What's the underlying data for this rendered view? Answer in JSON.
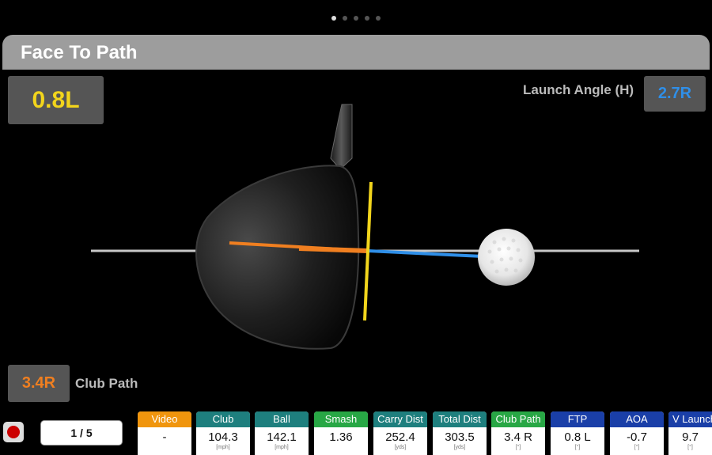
{
  "pager": {
    "page_count": 5,
    "active_index": 0
  },
  "header": {
    "title": "Face To Path"
  },
  "face_to_path": {
    "value": "0.8L",
    "color": "#f2d51c"
  },
  "launch_angle_h": {
    "label": "Launch Angle (H)",
    "value": "2.7R",
    "color": "#2f8fe8"
  },
  "club_path": {
    "label": "Club Path",
    "value": "3.4R",
    "color": "#f07f20"
  },
  "footer": {
    "record_icon": "record-icon",
    "counter": "1 / 5",
    "metrics": [
      {
        "label": "Video",
        "value": "-",
        "unit": "",
        "color": "#f0950d"
      },
      {
        "label": "Club",
        "value": "104.3",
        "unit": "[mph]",
        "color": "#1e7f7e"
      },
      {
        "label": "Ball",
        "value": "142.1",
        "unit": "[mph]",
        "color": "#1e7f7e"
      },
      {
        "label": "Smash",
        "value": "1.36",
        "unit": "",
        "color": "#28a745"
      },
      {
        "label": "Carry Dist",
        "value": "252.4",
        "unit": "[yds]",
        "color": "#1e7f7e"
      },
      {
        "label": "Total Dist",
        "value": "303.5",
        "unit": "[yds]",
        "color": "#1e7f7e"
      },
      {
        "label": "Club Path",
        "value": "3.4 R",
        "unit": "[°]",
        "color": "#28a745"
      },
      {
        "label": "FTP",
        "value": "0.8 L",
        "unit": "[°]",
        "color": "#1a3fa8"
      },
      {
        "label": "AOA",
        "value": "-0.7",
        "unit": "[°]",
        "color": "#1a3fa8"
      },
      {
        "label": "V Launch",
        "value": "9.7",
        "unit": "[°]",
        "color": "#1a3fa8"
      }
    ]
  }
}
